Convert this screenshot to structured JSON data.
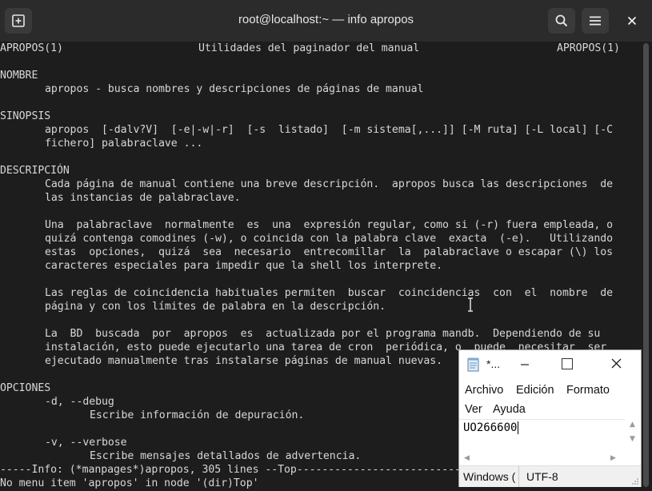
{
  "titlebar": {
    "title": "root@localhost:~ — info apropos"
  },
  "terminal": {
    "header_left": "APROPOS(1)",
    "header_center": "Utilidades del paginador del manual",
    "header_right": "APROPOS(1)",
    "nombre_heading": "NOMBRE",
    "nombre_text": "apropos - busca nombres y descripciones de páginas de manual",
    "sinopsis_heading": "SINOPSIS",
    "sinopsis_line1": "apropos  [-dalv?V]  [-e|-w|-r]  [-s  listado]  [-m sistema[,...]] [-M ruta] [-L local] [-C",
    "sinopsis_line2": "fichero] palabraclave ...",
    "desc_heading": "DESCRIPCIÓN",
    "desc_p1_l1": "Cada página de manual contiene una breve descripción.  apropos busca las descripciones  de",
    "desc_p1_l2": "las instancias de palabraclave.",
    "desc_p2_l1": "Una  palabraclave  normalmente  es  una  expresión regular, como si (-r) fuera empleada, o",
    "desc_p2_l2": "quizá contenga comodines (-w), o coincida con la palabra clave  exacta  (-e).   Utilizando",
    "desc_p2_l3": "estas  opciones,  quizá  sea  necesario  entrecomillar  la  palabraclave o escapar (\\) los",
    "desc_p2_l4": "caracteres especiales para impedir que la shell los interprete.",
    "desc_p3_l1": "Las reglas de coincidencia habituales permiten  buscar  coincidencias  con  el  nombre  de",
    "desc_p3_l2": "página y con los límites de palabra en la descripción.",
    "desc_p4_l1": "La  BD  buscada  por  apropos  es  actualizada por el programa mandb.  Dependiendo de su",
    "desc_p4_l2": "instalación, esto puede ejecutarlo una tarea de cron  periódica, o  puede  necesitar  ser",
    "desc_p4_l3": "ejecutado manualmente tras instalarse páginas de manual nuevas.",
    "opciones_heading": "OPCIONES",
    "opt1": "-d, --debug",
    "opt1_desc": "Escribe información de depuración.",
    "opt2": "-v, --verbose",
    "opt2_desc": "Escribe mensajes detallados de advertencia.",
    "modeline": "-----Info: (*manpages*)apropos, 305 lines --Top--------------------------------------------------------------------",
    "echo_line": "No menu item 'apropos' in node '(dir)Top'"
  },
  "notepad": {
    "title": "*...",
    "menu": [
      "Archivo",
      "Edición",
      "Formato",
      "Ver",
      "Ayuda"
    ],
    "content": "UO266600",
    "status_eol": "Windows (",
    "status_encoding": "UTF-8"
  }
}
